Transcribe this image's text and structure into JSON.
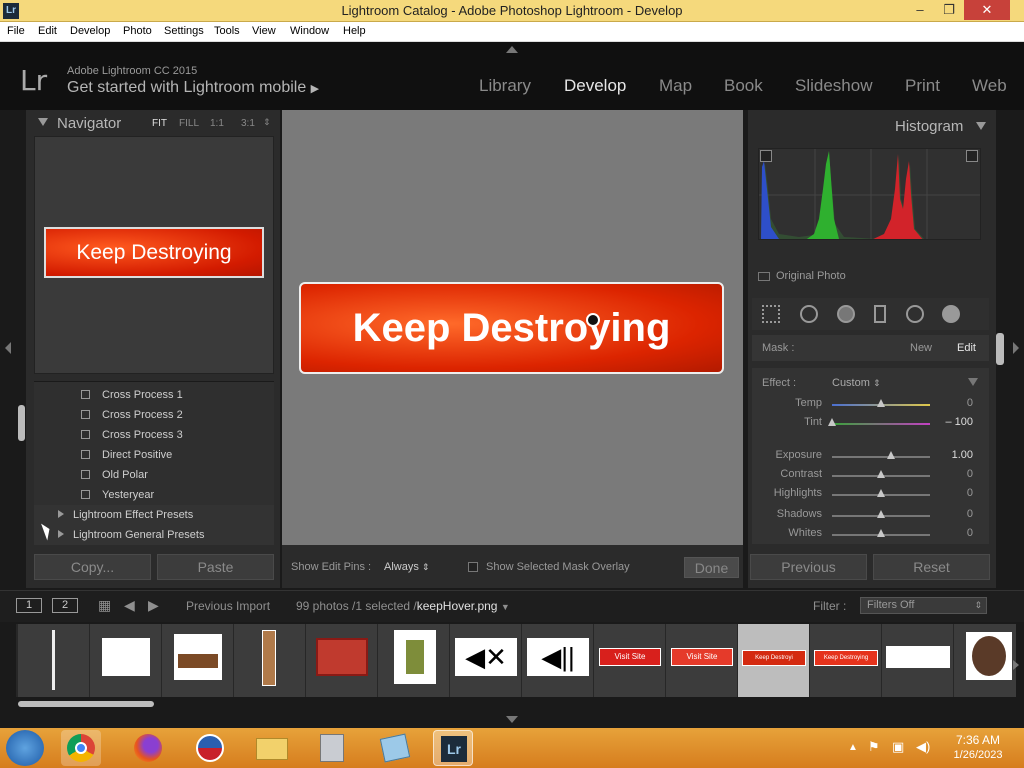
{
  "window": {
    "title": "Lightroom Catalog - Adobe Photoshop Lightroom - Develop",
    "app_icon": "Lr",
    "controls": [
      "–",
      "❐",
      "✕"
    ]
  },
  "menu": [
    "File",
    "Edit",
    "Develop",
    "Photo",
    "Settings",
    "Tools",
    "View",
    "Window",
    "Help"
  ],
  "header": {
    "logo": "Lr",
    "product": "Adobe Lightroom CC 2015",
    "mobile_prompt": "Get started with Lightroom mobile",
    "modules": [
      "Library",
      "Develop",
      "Map",
      "Book",
      "Slideshow",
      "Print",
      "Web"
    ],
    "active_module": "Develop"
  },
  "navigator": {
    "title": "Navigator",
    "zoom_options": [
      "FIT",
      "FILL",
      "1:1",
      "3:1"
    ],
    "active_zoom": "FIT",
    "preview_text": "Keep Destroying"
  },
  "presets": {
    "items": [
      "Cross Process 1",
      "Cross Process 2",
      "Cross Process 3",
      "Direct Positive",
      "Old Polar",
      "Yesteryear"
    ],
    "folders": [
      "Lightroom Effect Presets",
      "Lightroom General Presets"
    ]
  },
  "left_buttons": {
    "copy": "Copy...",
    "paste": "Paste"
  },
  "canvas": {
    "image_text": "Keep Destroying"
  },
  "center_toolbar": {
    "show_edit_pins_label": "Show Edit Pins :",
    "show_edit_pins_value": "Always",
    "mask_overlay_label": "Show Selected Mask Overlay",
    "done_label": "Done"
  },
  "histogram": {
    "title": "Histogram",
    "original_photo": "Original Photo"
  },
  "mask": {
    "label": "Mask :",
    "new": "New",
    "edit": "Edit"
  },
  "effect": {
    "label": "Effect :",
    "value": "Custom",
    "sliders": [
      {
        "name": "Temp",
        "value": "0",
        "pos": 0.5
      },
      {
        "name": "Tint",
        "value": "– 100",
        "pos": 0.0
      },
      {
        "name": "Exposure",
        "value": "1.00",
        "pos": 0.6
      },
      {
        "name": "Contrast",
        "value": "0",
        "pos": 0.5
      },
      {
        "name": "Highlights",
        "value": "0",
        "pos": 0.5
      },
      {
        "name": "Shadows",
        "value": "0",
        "pos": 0.5
      },
      {
        "name": "Whites",
        "value": "0",
        "pos": 0.5
      }
    ]
  },
  "right_buttons": {
    "previous": "Previous",
    "reset": "Reset"
  },
  "filmstrip_bar": {
    "screen1": "1",
    "screen2": "2",
    "source": "Previous Import",
    "count": "99 photos /1 selected /",
    "filename": "keepHover.png",
    "filter_label": "Filter :",
    "filter_value": "Filters Off"
  },
  "filmstrip": {
    "thumb_labels": [
      "Visit Site",
      "Visit Site",
      "Keep Destroyi",
      "Keep Destroying"
    ]
  },
  "taskbar": {
    "time": "7:36 AM",
    "date": "1/26/2023",
    "lr_label": "Lr"
  },
  "colors": {
    "accent": "#f5d97c",
    "taskbar": "#d67d1e",
    "button_red": "#dc2400"
  }
}
